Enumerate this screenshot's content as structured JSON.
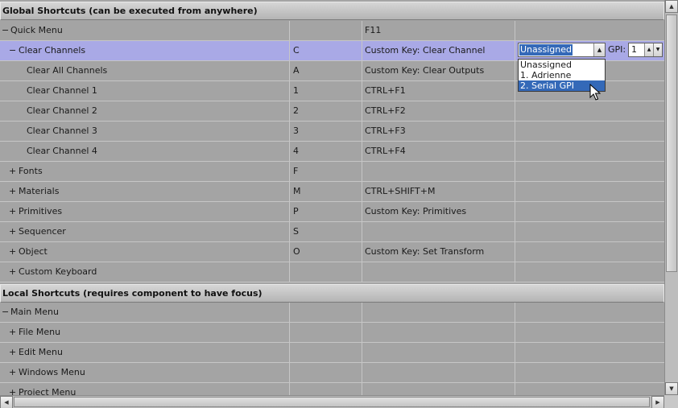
{
  "global_header": "Global Shortcuts (can be executed from anywhere)",
  "local_header": "Local Shortcuts (requires component to have focus)",
  "global_rows": [
    {
      "toggle": "−",
      "name": "Quick Menu",
      "key": "",
      "action": "F11",
      "level": 0
    },
    {
      "toggle": "−",
      "name": "Clear Channels",
      "key": "C",
      "action": "Custom Key: Clear Channel",
      "level": 1,
      "selected": true
    },
    {
      "toggle": "",
      "name": "Clear All Channels",
      "key": "A",
      "action": "Custom Key: Clear Outputs",
      "level": 2
    },
    {
      "toggle": "",
      "name": "Clear Channel 1",
      "key": "1",
      "action": "CTRL+F1",
      "level": 2
    },
    {
      "toggle": "",
      "name": "Clear Channel 2",
      "key": "2",
      "action": "CTRL+F2",
      "level": 2
    },
    {
      "toggle": "",
      "name": "Clear Channel 3",
      "key": "3",
      "action": "CTRL+F3",
      "level": 2
    },
    {
      "toggle": "",
      "name": "Clear Channel 4",
      "key": "4",
      "action": "CTRL+F4",
      "level": 2
    },
    {
      "toggle": "+",
      "name": "Fonts",
      "key": "F",
      "action": "",
      "level": 1
    },
    {
      "toggle": "+",
      "name": "Materials",
      "key": "M",
      "action": "CTRL+SHIFT+M",
      "level": 1
    },
    {
      "toggle": "+",
      "name": "Primitives",
      "key": "P",
      "action": "Custom Key: Primitives",
      "level": 1
    },
    {
      "toggle": "+",
      "name": "Sequencer",
      "key": "S",
      "action": "",
      "level": 1
    },
    {
      "toggle": "+",
      "name": "Object",
      "key": "O",
      "action": "Custom Key: Set Transform",
      "level": 1
    },
    {
      "toggle": "+",
      "name": "Custom Keyboard",
      "key": "",
      "action": "",
      "level": 1
    }
  ],
  "local_rows": [
    {
      "toggle": "−",
      "name": "Main Menu",
      "key": "",
      "action": "",
      "level": 0
    },
    {
      "toggle": "+",
      "name": "File Menu",
      "key": "",
      "action": "",
      "level": 1
    },
    {
      "toggle": "+",
      "name": "Edit Menu",
      "key": "",
      "action": "",
      "level": 1
    },
    {
      "toggle": "+",
      "name": "Windows Menu",
      "key": "",
      "action": "",
      "level": 1
    },
    {
      "toggle": "+",
      "name": "Project Menu",
      "key": "",
      "action": "",
      "level": 1
    }
  ],
  "gpi": {
    "selected": "Unassigned",
    "options": [
      "Unassigned",
      "1. Adrienne",
      "2. Serial GPI"
    ],
    "highlighted_index": 2,
    "label": "GPI:",
    "value": "1"
  },
  "icons": {
    "combo_arrow": "▲",
    "spin_up": "▲",
    "spin_down": "▼",
    "scroll_up": "▲",
    "scroll_down": "▼",
    "scroll_left": "◀",
    "scroll_right": "▶"
  }
}
